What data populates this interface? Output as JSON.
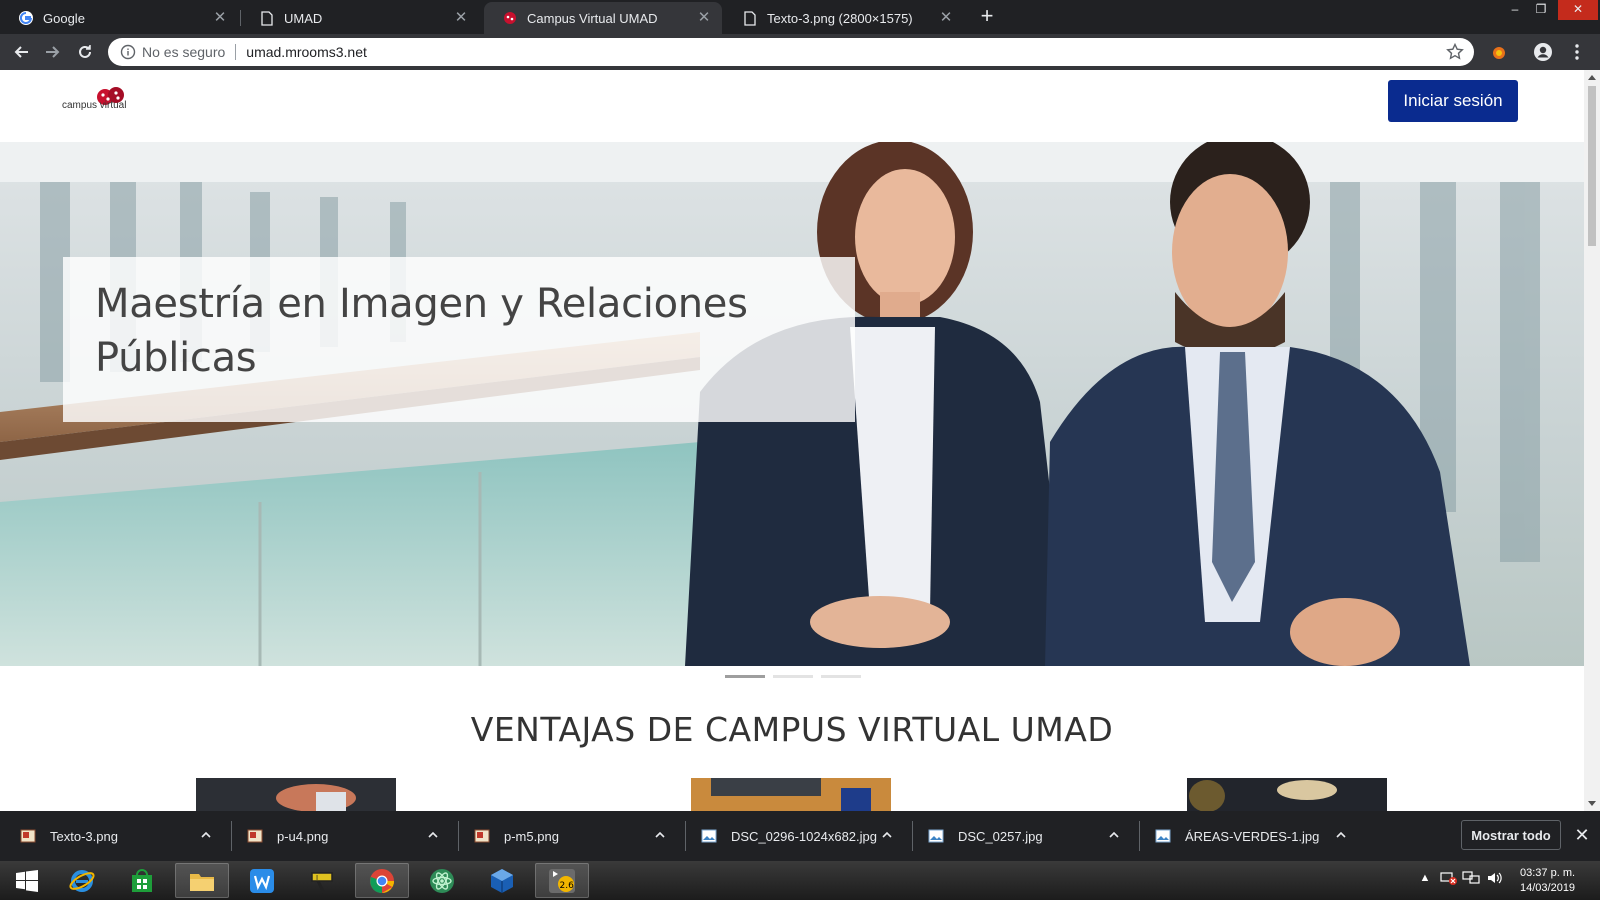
{
  "browser": {
    "tabs": [
      {
        "title": "Google",
        "icon": "google-icon",
        "active": false
      },
      {
        "title": "UMAD",
        "icon": "page-icon",
        "active": false
      },
      {
        "title": "Campus Virtual UMAD",
        "icon": "umad-favicon-icon",
        "active": true
      },
      {
        "title": "Texto-3.png (2800×1575)",
        "icon": "page-icon",
        "active": false
      }
    ],
    "security_label": "No es seguro",
    "url": "umad.mrooms3.net"
  },
  "page": {
    "logo_text": "campus virtual",
    "login_label": "Iniciar sesión",
    "hero_caption": "Maestría en Imagen y Relaciones Públicas",
    "carousel": {
      "slide_count": 3,
      "active_index": 0
    },
    "section_title": "VENTAJAS DE CAMPUS VIRTUAL UMAD"
  },
  "downloads": {
    "items": [
      {
        "name": "Texto-3.png",
        "icon": "png-file-icon"
      },
      {
        "name": "p-u4.png",
        "icon": "png-file-icon"
      },
      {
        "name": "p-m5.png",
        "icon": "png-file-icon"
      },
      {
        "name": "DSC_0296-1024x682.jpg",
        "icon": "jpg-file-icon"
      },
      {
        "name": "DSC_0257.jpg",
        "icon": "jpg-file-icon"
      },
      {
        "name": "ÁREAS-VERDES-1.jpg",
        "icon": "jpg-file-icon"
      }
    ],
    "show_all_label": "Mostrar todo"
  },
  "taskbar": {
    "apps": [
      "windows-start-icon",
      "internet-explorer-icon",
      "store-icon",
      "file-explorer-icon",
      "wps-icon",
      "tool-icon",
      "chrome-icon",
      "atom-icon",
      "virtualbox-icon",
      "gimp-icon"
    ],
    "gimp_badge": "2.6",
    "time": "03:37 p. m.",
    "date": "14/03/2019"
  }
}
